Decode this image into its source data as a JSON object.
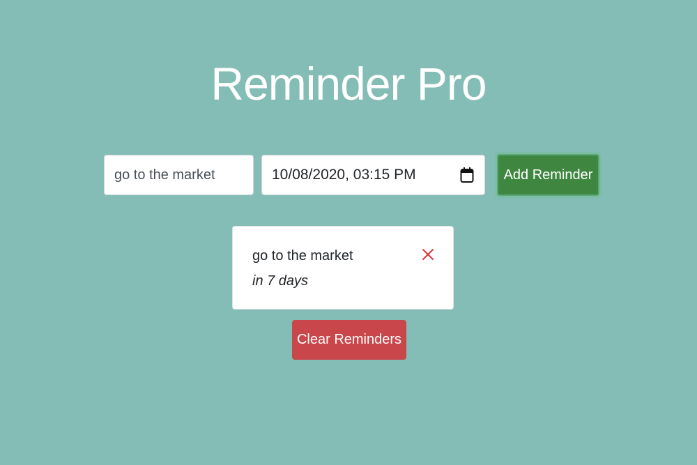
{
  "app": {
    "title": "Reminder Pro"
  },
  "form": {
    "text_value": "go to the market",
    "date_value": "10/08/2020, 03:15 PM",
    "calendar_icon": "calendar-icon",
    "add_label": "Add Reminder"
  },
  "reminders": [
    {
      "text": "go to the market",
      "due": "in 7 days",
      "delete_icon": "close-icon"
    }
  ],
  "actions": {
    "clear_label": "Clear Reminders"
  },
  "colors": {
    "background": "#83bdb5",
    "add_button": "#3f8740",
    "clear_button": "#c9464a",
    "delete_icon": "#e0353a"
  }
}
